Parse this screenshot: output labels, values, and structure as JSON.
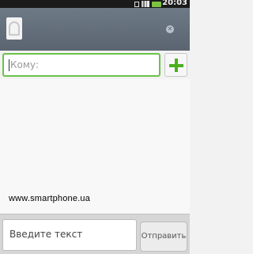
{
  "status_bar": {
    "time": "20:03"
  },
  "compose": {
    "to_placeholder": "Кому:",
    "message_placeholder": "Введите текст",
    "send_label": "Отправить"
  },
  "watermark": "www.smartphone.ua",
  "colors": {
    "accent": "#6cc24a",
    "header": "#5b6572"
  },
  "icons": [
    "avatar-icon",
    "close-icon",
    "add-contact-icon",
    "battery-icon",
    "signal-icon"
  ]
}
